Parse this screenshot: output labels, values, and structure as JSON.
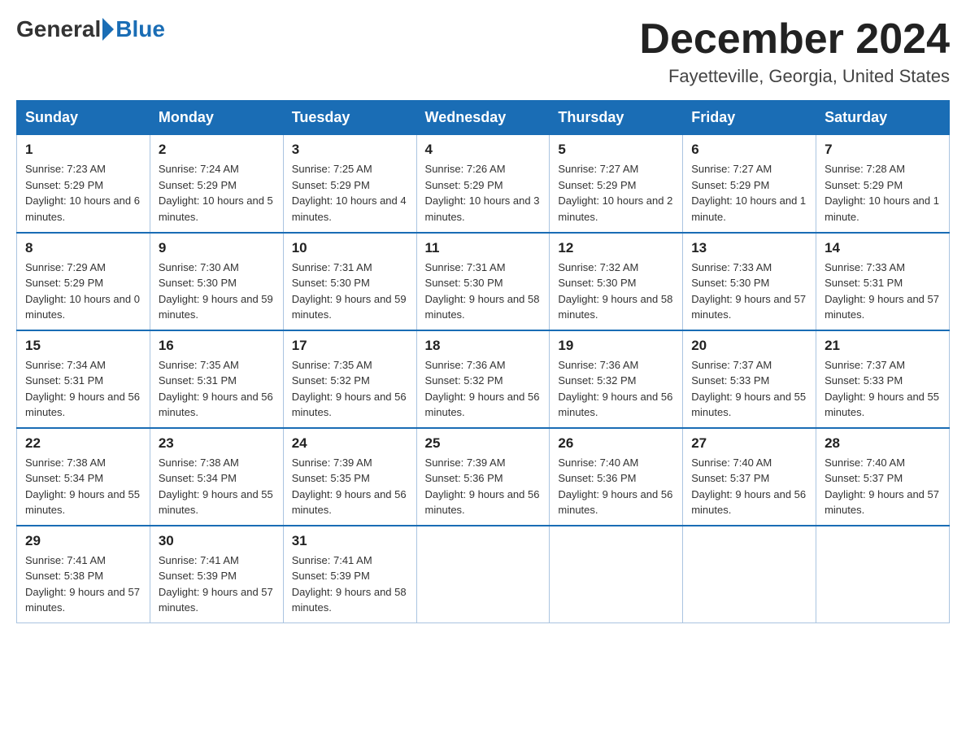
{
  "header": {
    "logo_general": "General",
    "logo_blue": "Blue",
    "month_title": "December 2024",
    "location": "Fayetteville, Georgia, United States"
  },
  "weekdays": [
    "Sunday",
    "Monday",
    "Tuesday",
    "Wednesday",
    "Thursday",
    "Friday",
    "Saturday"
  ],
  "weeks": [
    [
      {
        "day": "1",
        "sunrise": "7:23 AM",
        "sunset": "5:29 PM",
        "daylight": "10 hours and 6 minutes."
      },
      {
        "day": "2",
        "sunrise": "7:24 AM",
        "sunset": "5:29 PM",
        "daylight": "10 hours and 5 minutes."
      },
      {
        "day": "3",
        "sunrise": "7:25 AM",
        "sunset": "5:29 PM",
        "daylight": "10 hours and 4 minutes."
      },
      {
        "day": "4",
        "sunrise": "7:26 AM",
        "sunset": "5:29 PM",
        "daylight": "10 hours and 3 minutes."
      },
      {
        "day": "5",
        "sunrise": "7:27 AM",
        "sunset": "5:29 PM",
        "daylight": "10 hours and 2 minutes."
      },
      {
        "day": "6",
        "sunrise": "7:27 AM",
        "sunset": "5:29 PM",
        "daylight": "10 hours and 1 minute."
      },
      {
        "day": "7",
        "sunrise": "7:28 AM",
        "sunset": "5:29 PM",
        "daylight": "10 hours and 1 minute."
      }
    ],
    [
      {
        "day": "8",
        "sunrise": "7:29 AM",
        "sunset": "5:29 PM",
        "daylight": "10 hours and 0 minutes."
      },
      {
        "day": "9",
        "sunrise": "7:30 AM",
        "sunset": "5:30 PM",
        "daylight": "9 hours and 59 minutes."
      },
      {
        "day": "10",
        "sunrise": "7:31 AM",
        "sunset": "5:30 PM",
        "daylight": "9 hours and 59 minutes."
      },
      {
        "day": "11",
        "sunrise": "7:31 AM",
        "sunset": "5:30 PM",
        "daylight": "9 hours and 58 minutes."
      },
      {
        "day": "12",
        "sunrise": "7:32 AM",
        "sunset": "5:30 PM",
        "daylight": "9 hours and 58 minutes."
      },
      {
        "day": "13",
        "sunrise": "7:33 AM",
        "sunset": "5:30 PM",
        "daylight": "9 hours and 57 minutes."
      },
      {
        "day": "14",
        "sunrise": "7:33 AM",
        "sunset": "5:31 PM",
        "daylight": "9 hours and 57 minutes."
      }
    ],
    [
      {
        "day": "15",
        "sunrise": "7:34 AM",
        "sunset": "5:31 PM",
        "daylight": "9 hours and 56 minutes."
      },
      {
        "day": "16",
        "sunrise": "7:35 AM",
        "sunset": "5:31 PM",
        "daylight": "9 hours and 56 minutes."
      },
      {
        "day": "17",
        "sunrise": "7:35 AM",
        "sunset": "5:32 PM",
        "daylight": "9 hours and 56 minutes."
      },
      {
        "day": "18",
        "sunrise": "7:36 AM",
        "sunset": "5:32 PM",
        "daylight": "9 hours and 56 minutes."
      },
      {
        "day": "19",
        "sunrise": "7:36 AM",
        "sunset": "5:32 PM",
        "daylight": "9 hours and 56 minutes."
      },
      {
        "day": "20",
        "sunrise": "7:37 AM",
        "sunset": "5:33 PM",
        "daylight": "9 hours and 55 minutes."
      },
      {
        "day": "21",
        "sunrise": "7:37 AM",
        "sunset": "5:33 PM",
        "daylight": "9 hours and 55 minutes."
      }
    ],
    [
      {
        "day": "22",
        "sunrise": "7:38 AM",
        "sunset": "5:34 PM",
        "daylight": "9 hours and 55 minutes."
      },
      {
        "day": "23",
        "sunrise": "7:38 AM",
        "sunset": "5:34 PM",
        "daylight": "9 hours and 55 minutes."
      },
      {
        "day": "24",
        "sunrise": "7:39 AM",
        "sunset": "5:35 PM",
        "daylight": "9 hours and 56 minutes."
      },
      {
        "day": "25",
        "sunrise": "7:39 AM",
        "sunset": "5:36 PM",
        "daylight": "9 hours and 56 minutes."
      },
      {
        "day": "26",
        "sunrise": "7:40 AM",
        "sunset": "5:36 PM",
        "daylight": "9 hours and 56 minutes."
      },
      {
        "day": "27",
        "sunrise": "7:40 AM",
        "sunset": "5:37 PM",
        "daylight": "9 hours and 56 minutes."
      },
      {
        "day": "28",
        "sunrise": "7:40 AM",
        "sunset": "5:37 PM",
        "daylight": "9 hours and 57 minutes."
      }
    ],
    [
      {
        "day": "29",
        "sunrise": "7:41 AM",
        "sunset": "5:38 PM",
        "daylight": "9 hours and 57 minutes."
      },
      {
        "day": "30",
        "sunrise": "7:41 AM",
        "sunset": "5:39 PM",
        "daylight": "9 hours and 57 minutes."
      },
      {
        "day": "31",
        "sunrise": "7:41 AM",
        "sunset": "5:39 PM",
        "daylight": "9 hours and 58 minutes."
      },
      null,
      null,
      null,
      null
    ]
  ]
}
